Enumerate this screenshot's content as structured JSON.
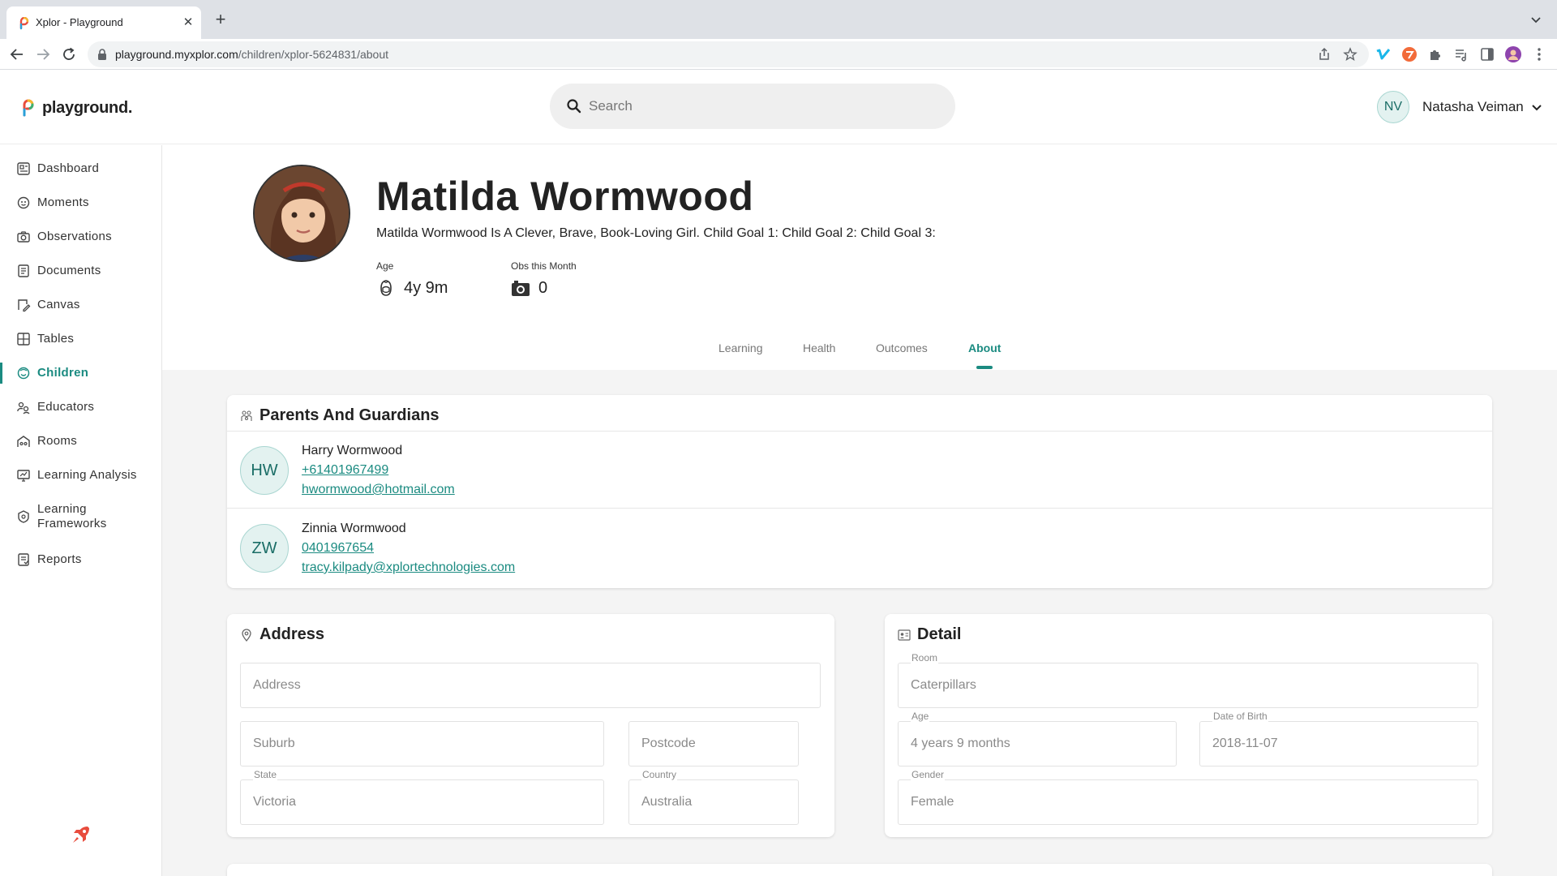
{
  "browser": {
    "tab_title": "Xplor - Playground",
    "url_host": "playground.myxplor.com",
    "url_path": "/children/xplor-5624831/about"
  },
  "header": {
    "logo_text": "playground.",
    "search_placeholder": "Search",
    "user_initials": "NV",
    "user_name": "Natasha Veiman"
  },
  "sidebar": {
    "items": [
      {
        "label": "Dashboard",
        "icon": "dashboard-icon"
      },
      {
        "label": "Moments",
        "icon": "moments-icon"
      },
      {
        "label": "Observations",
        "icon": "camera-icon"
      },
      {
        "label": "Documents",
        "icon": "documents-icon"
      },
      {
        "label": "Canvas",
        "icon": "canvas-icon"
      },
      {
        "label": "Tables",
        "icon": "table-icon"
      },
      {
        "label": "Children",
        "icon": "child-face-icon",
        "active": true
      },
      {
        "label": "Educators",
        "icon": "educators-icon"
      },
      {
        "label": "Rooms",
        "icon": "rooms-icon"
      },
      {
        "label": "Learning Analysis",
        "icon": "analysis-icon"
      },
      {
        "label": "Learning\nFrameworks",
        "icon": "frameworks-icon"
      },
      {
        "label": "Reports",
        "icon": "reports-icon"
      }
    ]
  },
  "profile": {
    "name": "Matilda Wormwood",
    "description": "Matilda Wormwood Is A Clever, Brave, Book-Loving Girl. Child Goal 1: Child Goal 2: Child Goal 3:",
    "age_label": "Age",
    "age_value": "4y 9m",
    "obs_label": "Obs this Month",
    "obs_value": "0"
  },
  "tabs": [
    "Learning",
    "Health",
    "Outcomes",
    "About"
  ],
  "active_tab": "About",
  "guardians": {
    "title": "Parents And Guardians",
    "items": [
      {
        "initials": "HW",
        "name": "Harry Wormwood",
        "phone": "+61401967499",
        "email": "hwormwood@hotmail.com"
      },
      {
        "initials": "ZW",
        "name": "Zinnia Wormwood",
        "phone": "0401967654",
        "email": "tracy.kilpady@xplortechnologies.com"
      }
    ]
  },
  "address": {
    "title": "Address",
    "address_placeholder": "Address",
    "suburb_placeholder": "Suburb",
    "postcode_placeholder": "Postcode",
    "state_label": "State",
    "state_value": "Victoria",
    "country_label": "Country",
    "country_value": "Australia"
  },
  "detail": {
    "title": "Detail",
    "room_label": "Room",
    "room_value": "Caterpillars",
    "age_label": "Age",
    "age_value": "4 years 9 months",
    "dob_label": "Date of Birth",
    "dob_value": "2018-11-07",
    "gender_label": "Gender",
    "gender_value": "Female"
  },
  "colors": {
    "accent": "#1b8b81",
    "avatar_bg": "#e3f2f0",
    "page_bg": "#f4f4f4"
  }
}
